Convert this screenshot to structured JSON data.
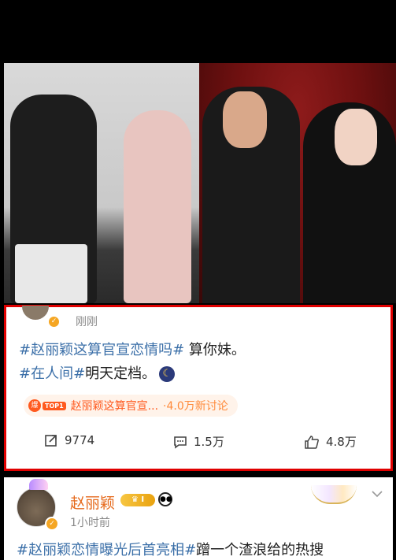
{
  "post1": {
    "time": "刚刚",
    "line1_topic": "#赵丽颖这算官宣恋情吗#",
    "line1_text": " 算你妹。",
    "line2_topic": "#在人间#",
    "line2_text": "明天定档。",
    "hot_badge": "TOP1",
    "hot_title": "赵丽颖这算官宣...",
    "hot_count": "·4.0万新讨论",
    "reposts": "9774",
    "comments": "1.5万",
    "likes": "4.8万"
  },
  "post2": {
    "username": "赵丽颖",
    "vip_level": "I",
    "time": "1小时前",
    "topic": "#赵丽颖恋情曝光后首亮相#",
    "text": "蹭一个渣浪给的热搜"
  },
  "icons": {
    "repost": "repost-icon",
    "comment": "comment-icon",
    "like": "thumbs-up-icon",
    "more": "chevron-down-icon",
    "verified": "verified-badge-icon"
  },
  "colors": {
    "topic": "#3b6fa8",
    "highlight_border": "#e00000",
    "username": "#e66a1c",
    "hot": "#ff5a1f"
  }
}
